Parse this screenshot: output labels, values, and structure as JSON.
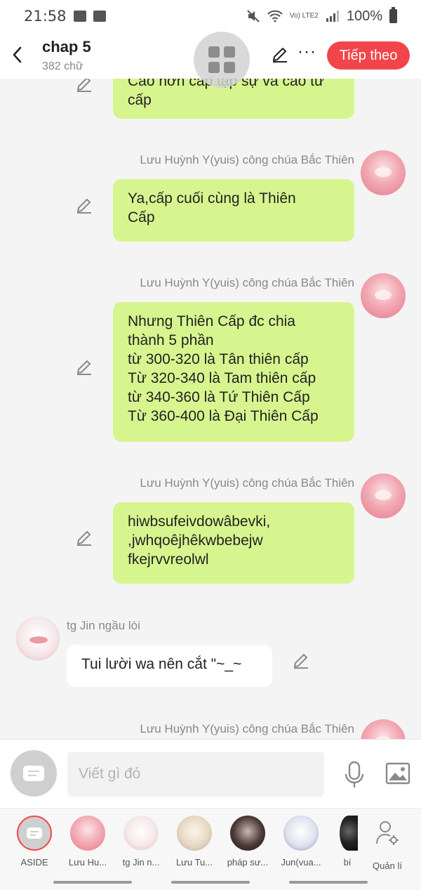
{
  "status_bar": {
    "time": "21:58",
    "network_label": "Vo) LTE2",
    "battery": "100%"
  },
  "header": {
    "title": "chap 5",
    "subtitle": "382 chữ",
    "next_label": "Tiếp theo",
    "more_label": "···"
  },
  "messages": [
    {
      "sender": "",
      "line1": "Cao hơn cấp tập sự và cao tư",
      "line2": "cấp"
    },
    {
      "sender": "Lưu Huỳnh Y(yuis) công chúa Bắc Thiên",
      "line1": "Ya,cấp cuối cùng là Thiên",
      "line2": "Cấp"
    },
    {
      "sender": "Lưu Huỳnh Y(yuis) công chúa Bắc Thiên",
      "lines": [
        "Nhưng Thiên Cấp đc chia",
        "thành 5 phần",
        "từ 300-320 là Tân thiên cấp",
        "Từ 320-340 là Tam thiên cấp",
        "từ 340-360 là Tứ Thiên Cấp",
        "Từ 360-400 là Đại Thiên Cấp"
      ]
    },
    {
      "sender": "Lưu Huỳnh Y(yuis) công chúa Bắc Thiên",
      "lines": [
        "hiwbsufeivdowâbevki,",
        ",jwhqoêjhêkwbebejw",
        "fkejrvvreolwl"
      ]
    },
    {
      "sender": "tg Jin ngầu lòi",
      "line1": "Tui lười wa nên cắt \"~_~"
    },
    {
      "sender": "Lưu Huỳnh Y(yuis) công chúa Bắc Thiên"
    }
  ],
  "input": {
    "placeholder": "Viết gì đó"
  },
  "characters": [
    {
      "name": "ASIDE"
    },
    {
      "name": "Lưu Hu..."
    },
    {
      "name": "tg Jin n..."
    },
    {
      "name": "Lưu Tu..."
    },
    {
      "name": "pháp sư..."
    },
    {
      "name": "Jun(vua..."
    },
    {
      "name": "bí"
    },
    {
      "name": "Quản lí"
    }
  ],
  "colors": {
    "accent": "#f2454b",
    "bubble_green": "#d7f58f",
    "bubble_white": "#ffffff",
    "background": "#f4f4f4"
  }
}
